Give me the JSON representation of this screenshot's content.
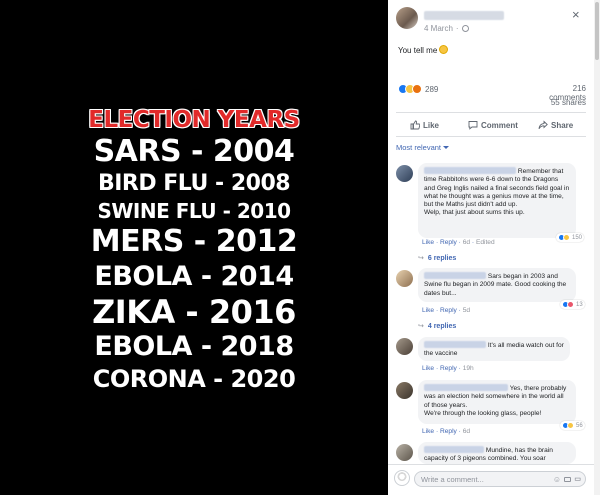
{
  "meme": {
    "title": "ELECTION YEARS",
    "lines": [
      "SARS - 2004",
      "BIRD FLU - 2008",
      "SWINE FLU - 2010",
      "MERS - 2012",
      "EBOLA - 2014",
      "ZIKA - 2016",
      "EBOLA - 2018",
      "CORONA - 2020"
    ]
  },
  "post": {
    "date": "4 March",
    "date_separator": "·",
    "text": "You tell me",
    "reactions_count": "289",
    "comments_count": "216 comments",
    "shares_count": "55 shares",
    "close_glyph": "×"
  },
  "actions": {
    "like": "Like",
    "comment": "Comment",
    "share": "Share"
  },
  "filter": {
    "label": "Most relevant"
  },
  "comments": [
    {
      "text": "Remember that time Rabbitohs were 6-6 down to the Dragons and Greg Inglis nailed a final seconds field goal in what he thought was a genius move at the time, but the Maths just didn't add up.\nWelp, that just about sums this up.",
      "like": "Like",
      "reply": "Reply",
      "time": "6d",
      "edited": "Edited",
      "reaction_count": "150",
      "replies": "6 replies"
    },
    {
      "text": "Sars began in 2003 and Swine flu began in 2009 mate. Good cooking the dates but...",
      "like": "Like",
      "reply": "Reply",
      "time": "5d",
      "reaction_count": "13",
      "replies": "4 replies"
    },
    {
      "text": "It's all media watch out for the vaccine",
      "like": "Like",
      "reply": "Reply",
      "time": "19h"
    },
    {
      "text": "Yes, there probably was an election held somewhere in the world all of those years.\nWe're through the looking glass, people!",
      "like": "Like",
      "reply": "Reply",
      "time": "6d",
      "reaction_count": "56"
    },
    {
      "text": "Mundine, has the brain capacity of 3 pigeons combined. You soar"
    }
  ],
  "composer": {
    "placeholder": "Write a comment..."
  },
  "colors": {
    "accent": "#4267b2",
    "meme_title": "#e12a2a"
  }
}
